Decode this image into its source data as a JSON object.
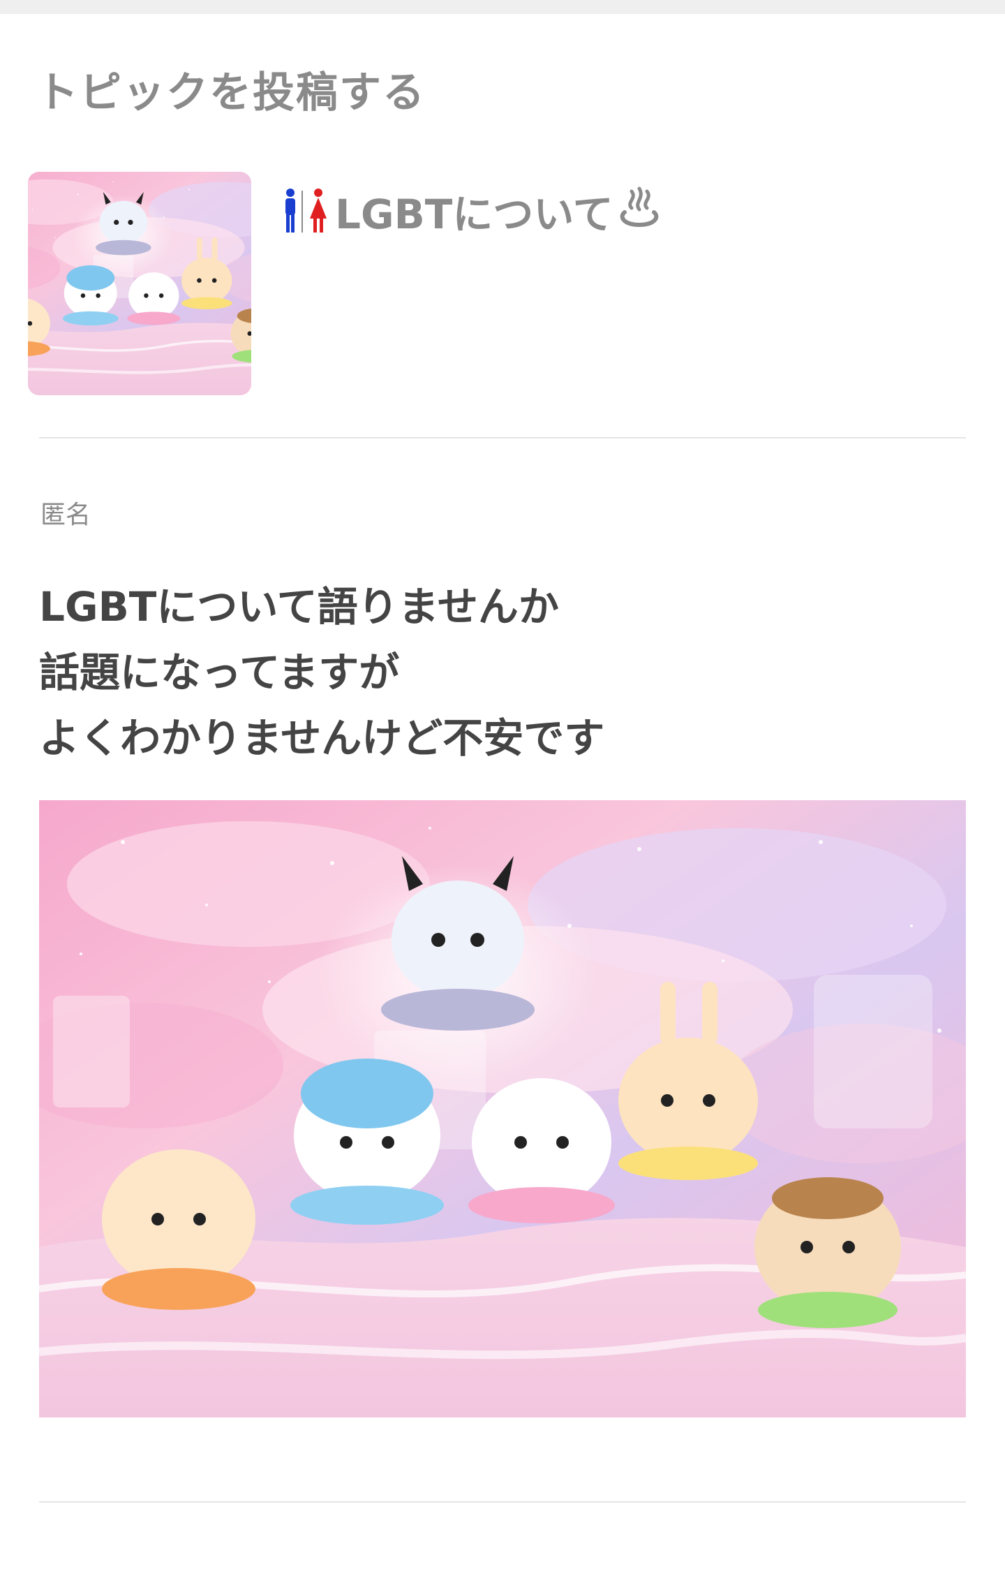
{
  "header": {
    "title": "トピックを投稿する"
  },
  "topic": {
    "title": "LGBTについて",
    "title_prefix_icon": "restroom-icon",
    "title_suffix_icon": "hot-springs-icon"
  },
  "post": {
    "author": "匿名",
    "body_lines": [
      "LGBTについて語りませんか",
      "話題になってますが",
      "よくわかりませんけど不安です"
    ]
  },
  "colors": {
    "title_gray": "#8a8a8a",
    "body_text": "#444444",
    "divider": "#e5e5e5",
    "male_blue": "#1a3fd0",
    "female_red": "#e02020"
  }
}
